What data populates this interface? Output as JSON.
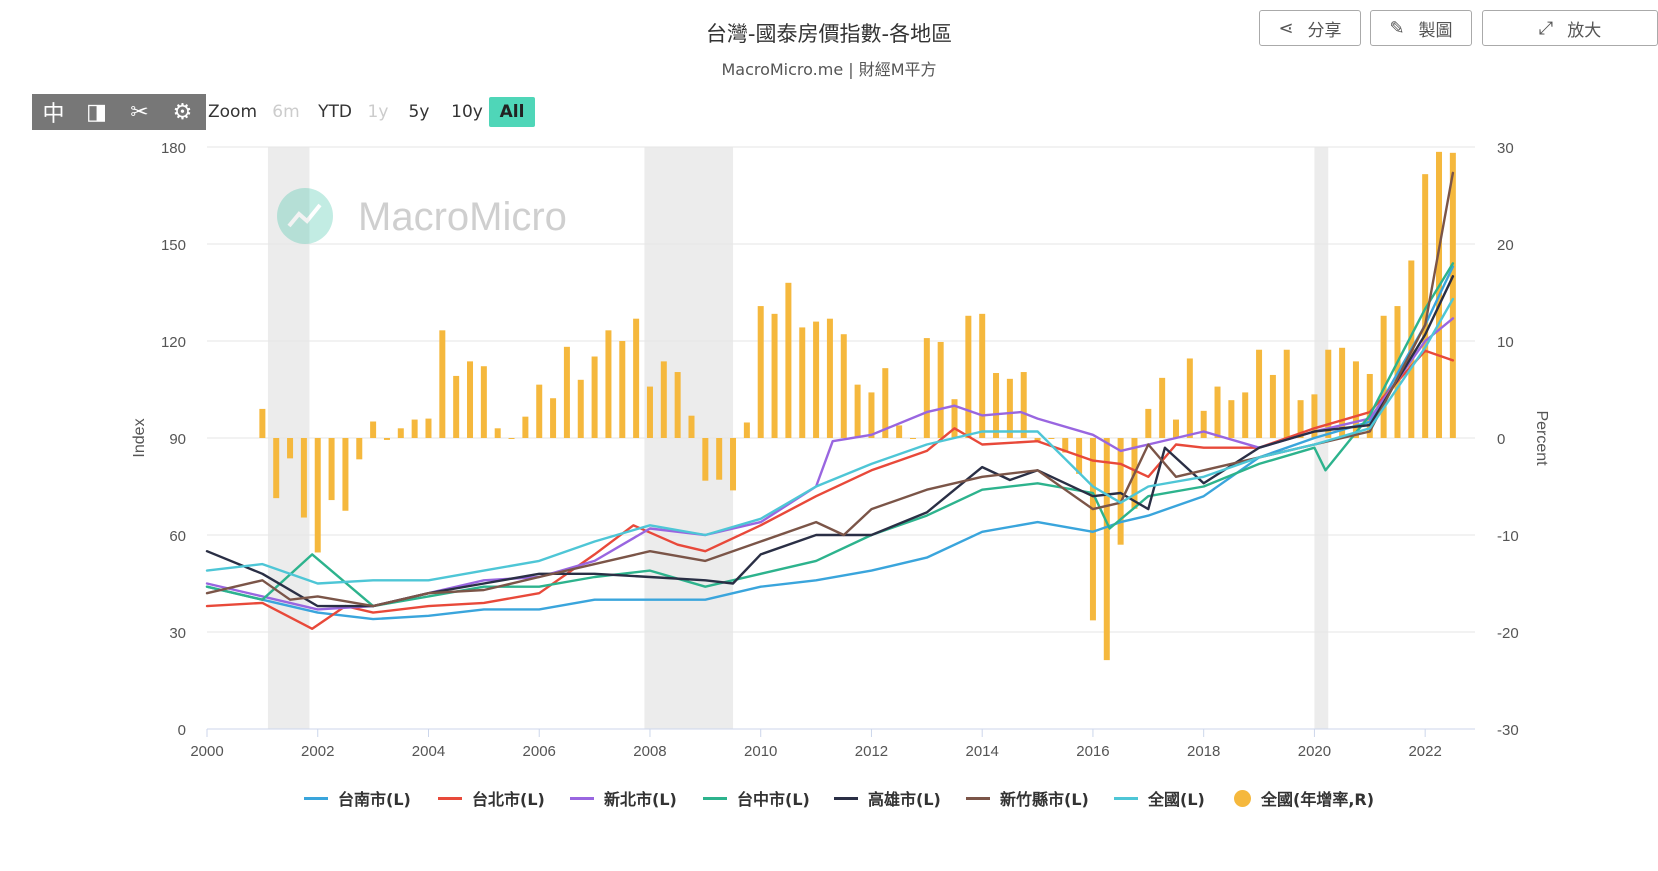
{
  "header": {
    "title": "台灣-國泰房價指數-各地區",
    "subtitle": "MacroMicro.me | 財經M平方"
  },
  "buttons": {
    "share": "分享",
    "chart": "製圖",
    "expand": "放大"
  },
  "toolbar": {
    "zoom_label": "Zoom",
    "ranges": [
      "6m",
      "YTD",
      "1y",
      "5y",
      "10y",
      "All"
    ],
    "active_range": "All",
    "disabled_ranges": [
      "6m",
      "1y"
    ],
    "icons": [
      "crosshair-icon",
      "half-panel-icon",
      "scissors-icon",
      "gear-icon"
    ]
  },
  "watermark": "MacroMicro",
  "colors": {
    "台南市": "#3aa5dc",
    "台北市": "#e8493a",
    "新北市": "#9966e0",
    "台中市": "#2db38d",
    "高雄市": "#2a2f45",
    "新竹縣市": "#7b5548",
    "全國": "#4ec6d6",
    "bar": "#f5b83d",
    "recession": "#ececec"
  },
  "chart_data": {
    "type": "line+bar",
    "x_axis": {
      "range": [
        2000,
        2022.9
      ],
      "ticks": [
        "2000",
        "2002",
        "2004",
        "2006",
        "2008",
        "2010",
        "2012",
        "2014",
        "2016",
        "2018",
        "2020",
        "2022"
      ]
    },
    "y_left": {
      "label": "Index",
      "range": [
        0,
        180
      ],
      "ticks": [
        "0",
        "30",
        "60",
        "90",
        "120",
        "150",
        "180"
      ]
    },
    "y_right": {
      "label": "Percent",
      "range": [
        -30,
        30
      ],
      "ticks": [
        "-30",
        "-20",
        "-10",
        "0",
        "10",
        "20",
        "30"
      ]
    },
    "recessions": [
      [
        2001.1,
        2001.85
      ],
      [
        2007.9,
        2009.5
      ],
      [
        2020.0,
        2020.25
      ]
    ],
    "series": [
      {
        "name": "台南市(L)",
        "key": "台南市",
        "axis": "left",
        "x": [
          2000,
          2001,
          2002,
          2003,
          2004,
          2005,
          2006,
          2007,
          2008,
          2009,
          2010,
          2011,
          2012,
          2013,
          2014,
          2015,
          2016,
          2016.5,
          2017,
          2018,
          2019,
          2020,
          2021,
          2022,
          2022.5
        ],
        "y": [
          44,
          40,
          36,
          34,
          35,
          37,
          37,
          40,
          40,
          40,
          44,
          46,
          49,
          53,
          61,
          64,
          61,
          64,
          66,
          72,
          84,
          90,
          95,
          125,
          143
        ]
      },
      {
        "name": "台北市(L)",
        "key": "台北市",
        "axis": "left",
        "x": [
          2000,
          2001,
          2001.9,
          2002.5,
          2003,
          2004,
          2005,
          2006,
          2007,
          2007.7,
          2008.5,
          2009,
          2010,
          2011,
          2012,
          2012.5,
          2013,
          2013.5,
          2014,
          2015,
          2016,
          2016.5,
          2017,
          2017.5,
          2018,
          2019,
          2020,
          2021,
          2022,
          2022.5
        ],
        "y": [
          38,
          39,
          31,
          38,
          36,
          38,
          39,
          42,
          54,
          63,
          57,
          55,
          63,
          72,
          80,
          83,
          86,
          93,
          88,
          89,
          83,
          82,
          78,
          88,
          87,
          87,
          93,
          98,
          117,
          114
        ]
      },
      {
        "name": "新北市(L)",
        "key": "新北市",
        "axis": "left",
        "x": [
          2000,
          2001,
          2002,
          2003,
          2004,
          2005,
          2006,
          2007,
          2008,
          2009,
          2010,
          2011,
          2011.3,
          2012,
          2013,
          2013.5,
          2014,
          2014.7,
          2015,
          2016,
          2016.5,
          2017,
          2018,
          2019,
          2020,
          2021,
          2022,
          2022.5
        ],
        "y": [
          45,
          41,
          37,
          38,
          42,
          46,
          47,
          52,
          62,
          60,
          64,
          75,
          89,
          91,
          98,
          100,
          97,
          98,
          96,
          91,
          86,
          88,
          92,
          87,
          92,
          96,
          120,
          127
        ]
      },
      {
        "name": "台中市(L)",
        "key": "台中市",
        "axis": "left",
        "x": [
          2000,
          2001,
          2001.9,
          2003,
          2004,
          2005,
          2006,
          2007,
          2008,
          2009,
          2010,
          2011,
          2012,
          2013,
          2014,
          2015,
          2016,
          2016.3,
          2017,
          2018,
          2019,
          2020,
          2020.2,
          2021,
          2022,
          2022.5
        ],
        "y": [
          44,
          40,
          54,
          38,
          41,
          44,
          44,
          47,
          49,
          44,
          48,
          52,
          60,
          66,
          74,
          76,
          73,
          62,
          72,
          75,
          82,
          87,
          80,
          97,
          130,
          144
        ]
      },
      {
        "name": "高雄市(L)",
        "key": "高雄市",
        "axis": "left",
        "x": [
          2000,
          2001,
          2002,
          2003,
          2004,
          2005,
          2006,
          2007,
          2008,
          2009,
          2009.5,
          2010,
          2011,
          2012,
          2013,
          2014,
          2014.5,
          2015,
          2016,
          2016.5,
          2017,
          2017.3,
          2018,
          2019,
          2020,
          2021,
          2022,
          2022.5
        ],
        "y": [
          55,
          48,
          38,
          38,
          42,
          45,
          48,
          48,
          47,
          46,
          45,
          54,
          60,
          60,
          67,
          81,
          77,
          80,
          72,
          73,
          68,
          87,
          76,
          87,
          92,
          94,
          122,
          140
        ]
      },
      {
        "name": "新竹縣市(L)",
        "key": "新竹縣市",
        "axis": "left",
        "x": [
          2000,
          2001,
          2001.5,
          2002,
          2003,
          2004,
          2005,
          2006,
          2007,
          2008,
          2009,
          2010,
          2011,
          2011.5,
          2012,
          2013,
          2014,
          2015,
          2016,
          2016.5,
          2017,
          2017.5,
          2018,
          2019,
          2020,
          2021,
          2022,
          2022.5
        ],
        "y": [
          42,
          46,
          40,
          41,
          38,
          42,
          43,
          47,
          51,
          55,
          52,
          58,
          64,
          60,
          68,
          74,
          78,
          80,
          68,
          70,
          88,
          78,
          80,
          84,
          88,
          92,
          125,
          172
        ]
      },
      {
        "name": "全國(L)",
        "key": "全國",
        "axis": "left",
        "x": [
          2000,
          2001,
          2002,
          2003,
          2004,
          2005,
          2006,
          2007,
          2008,
          2009,
          2010,
          2011,
          2012,
          2013,
          2014,
          2015,
          2016,
          2016.5,
          2017,
          2018,
          2019,
          2020,
          2021,
          2022,
          2022.5
        ],
        "y": [
          49,
          51,
          45,
          46,
          46,
          49,
          52,
          58,
          63,
          60,
          65,
          75,
          82,
          88,
          92,
          92,
          75,
          70,
          75,
          78,
          84,
          88,
          93,
          118,
          133
        ]
      },
      {
        "name": "全國(年增率,R)",
        "key": "bar",
        "axis": "right",
        "type": "bar",
        "x": [
          2001.0,
          2001.25,
          2001.5,
          2001.75,
          2002.0,
          2002.25,
          2002.5,
          2002.75,
          2003.0,
          2003.25,
          2003.5,
          2003.75,
          2004.0,
          2004.25,
          2004.5,
          2004.75,
          2005.0,
          2005.25,
          2005.5,
          2005.75,
          2006.0,
          2006.25,
          2006.5,
          2006.75,
          2007.0,
          2007.25,
          2007.5,
          2007.75,
          2008.0,
          2008.25,
          2008.5,
          2008.75,
          2009.0,
          2009.25,
          2009.5,
          2009.75,
          2010.0,
          2010.25,
          2010.5,
          2010.75,
          2011.0,
          2011.25,
          2011.5,
          2011.75,
          2012.0,
          2012.25,
          2012.5,
          2012.75,
          2013.0,
          2013.25,
          2013.5,
          2013.75,
          2014.0,
          2014.25,
          2014.5,
          2014.75,
          2015.0,
          2015.25,
          2015.5,
          2015.75,
          2016.0,
          2016.25,
          2016.5,
          2016.75,
          2017.0,
          2017.25,
          2017.5,
          2017.75,
          2018.0,
          2018.25,
          2018.5,
          2018.75,
          2019.0,
          2019.25,
          2019.5,
          2019.75,
          2020.0,
          2020.25,
          2020.5,
          2020.75,
          2021.0,
          2021.25,
          2021.5,
          2021.75,
          2022.0,
          2022.25,
          2022.5
        ],
        "y": [
          3,
          -6.2,
          -2.1,
          -8.2,
          -11.8,
          -6.4,
          -7.5,
          -2.2,
          1.7,
          -0.2,
          1,
          1.9,
          2,
          11.1,
          6.4,
          7.9,
          7.4,
          1,
          0,
          2.2,
          5.5,
          4.1,
          9.4,
          6,
          8.4,
          11.1,
          10,
          12.3,
          5.3,
          7.9,
          6.8,
          2.3,
          -4.4,
          -4.3,
          -5.4,
          1.6,
          13.6,
          12.8,
          16,
          11.4,
          12,
          12.3,
          10.7,
          5.5,
          4.7,
          7.2,
          1.3,
          0,
          10.3,
          9.9,
          4,
          12.6,
          12.8,
          6.7,
          6.1,
          6.8,
          -0.3,
          0,
          -1.5,
          -3.7,
          -18.8,
          -22.9,
          -11,
          -7.3,
          3,
          6.2,
          1.9,
          8.2,
          2.8,
          5.3,
          3.9,
          4.7,
          9.1,
          6.5,
          9.1,
          3.9,
          4.5,
          9.1,
          9.3,
          7.9,
          6.6,
          12.6,
          13.6,
          18.3,
          27.2,
          29.5,
          29.4
        ]
      }
    ]
  }
}
